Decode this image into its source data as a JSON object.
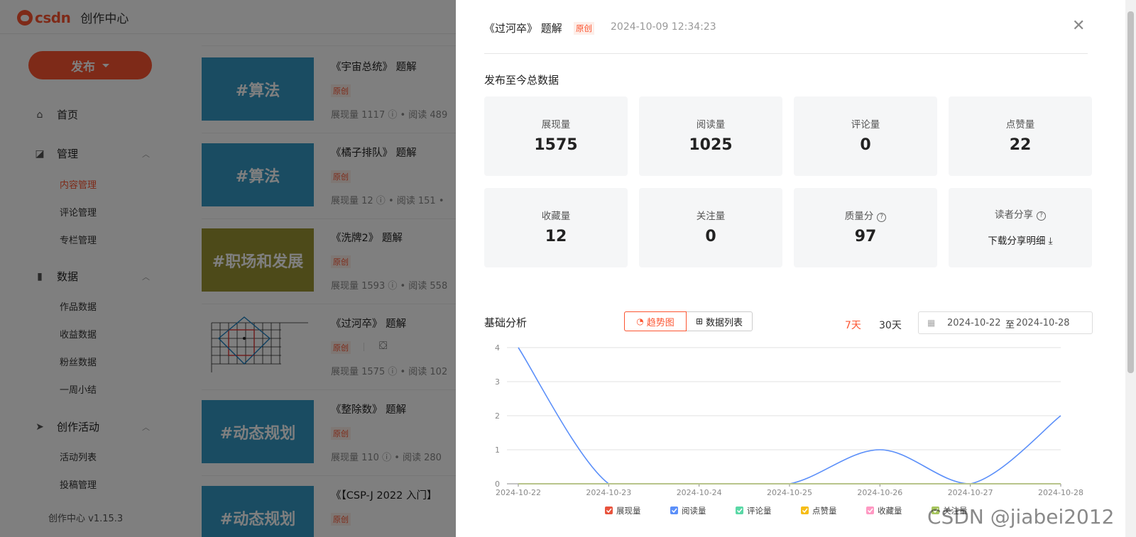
{
  "app": {
    "logo_text": "csdn",
    "subtitle": "创作中心",
    "brand_color": "#fc5531"
  },
  "sidebar": {
    "publish_label": "发布",
    "groups": [
      {
        "label": "首页",
        "icon": "home-icon"
      },
      {
        "label": "管理",
        "icon": "chart-icon",
        "items": [
          "内容管理",
          "评论管理",
          "专栏管理"
        ],
        "active": "内容管理"
      },
      {
        "label": "数据",
        "icon": "bar-chart-icon",
        "items": [
          "作品数据",
          "收益数据",
          "粉丝数据",
          "一周小结"
        ]
      },
      {
        "label": "创作活动",
        "icon": "paper-plane-icon",
        "items": [
          "活动列表",
          "投稿管理"
        ]
      }
    ],
    "version": "创作中心 v1.15.3"
  },
  "articles": [
    {
      "title": "《宇宙总统》 题解",
      "tag": "原创",
      "thumb": "#算法",
      "meta": "展现量 1117 ⓘ • 阅读 489"
    },
    {
      "title": "《橘子排队》 题解",
      "tag": "原创",
      "thumb": "#算法",
      "meta": "展现量 12 ⓘ • 阅读 151 •"
    },
    {
      "title": "《洗牌2》 题解",
      "tag": "原创",
      "thumb": "#职场和发展",
      "meta": "展现量 1593 ⓘ • 阅读 558"
    },
    {
      "title": "《过河卒》 题解",
      "tag": "原创",
      "thumb": "",
      "meta": "展现量 1575 ⓘ • 阅读 102"
    },
    {
      "title": "《整除数》 题解",
      "tag": "原创",
      "thumb": "#动态规划",
      "meta": "展现量 110 ⓘ • 阅读 280"
    },
    {
      "title": "《【CSP-J 2022 入门】",
      "tag": "原创",
      "thumb": "#动态规划",
      "meta": ""
    }
  ],
  "drawer": {
    "title": "《过河卒》 题解",
    "tag": "原创",
    "time": "2024-10-09 12:34:23",
    "section_title": "发布至今总数据",
    "stats": [
      {
        "label": "展现量",
        "value": "1575"
      },
      {
        "label": "阅读量",
        "value": "1025"
      },
      {
        "label": "评论量",
        "value": "0"
      },
      {
        "label": "点赞量",
        "value": "22"
      },
      {
        "label": "收藏量",
        "value": "12"
      },
      {
        "label": "关注量",
        "value": "0"
      },
      {
        "label": "质量分",
        "value": "97"
      },
      {
        "label": "读者分享",
        "value": "下载分享明细"
      }
    ],
    "analysis_title": "基础分析",
    "view_trend": "趋势图",
    "view_table": "数据列表",
    "range_7": "7天",
    "range_30": "30天",
    "date_from": "2024-10-22",
    "date_sep": "至",
    "date_to": "2024-10-28"
  },
  "chart_data": {
    "type": "line",
    "x": [
      "2024-10-22",
      "2024-10-23",
      "2024-10-24",
      "2024-10-25",
      "2024-10-26",
      "2024-10-27",
      "2024-10-28"
    ],
    "ylim": [
      0,
      4
    ],
    "yticks": [
      0,
      1,
      2,
      3,
      4
    ],
    "grid": true,
    "legend_position": "bottom",
    "series": [
      {
        "name": "展现量",
        "values": [
          0,
          0,
          0,
          0,
          0,
          0,
          0
        ],
        "color": "#e8533d"
      },
      {
        "name": "阅读量",
        "values": [
          4,
          0,
          0,
          0,
          1,
          0,
          2
        ],
        "color": "#5b8ff9"
      },
      {
        "name": "评论量",
        "values": [
          0,
          0,
          0,
          0,
          0,
          0,
          0
        ],
        "color": "#5ad8a6"
      },
      {
        "name": "点赞量",
        "values": [
          0,
          0,
          0,
          0,
          0,
          0,
          0
        ],
        "color": "#f6bd16"
      },
      {
        "name": "收藏量",
        "values": [
          0,
          0,
          0,
          0,
          0,
          0,
          0
        ],
        "color": "#ff99c3"
      },
      {
        "name": "关注量",
        "values": [
          0,
          0,
          0,
          0,
          0,
          0,
          0
        ],
        "color": "#a8c65f"
      }
    ]
  },
  "watermark": "CSDN @jiabei2012"
}
